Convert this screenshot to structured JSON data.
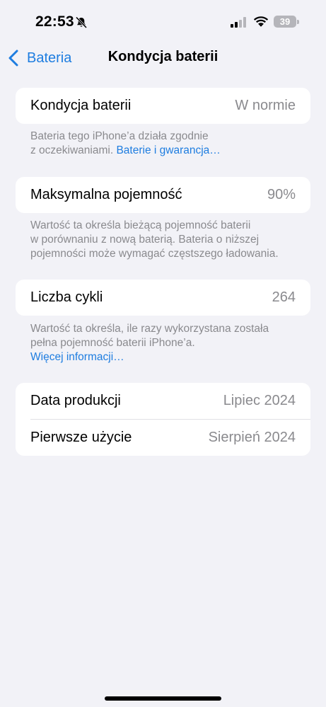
{
  "status_bar": {
    "time": "22:53",
    "battery_level": "39"
  },
  "nav": {
    "back_label": "Bateria",
    "title": "Kondycja baterii"
  },
  "sections": {
    "health": {
      "label": "Kondycja baterii",
      "value": "W normie",
      "note_line1": "Bateria tego iPhone’a działa zgodnie",
      "note_line2": "z oczekiwaniami.",
      "note_link": "Baterie i gwarancja…"
    },
    "capacity": {
      "label": "Maksymalna pojemność",
      "value": "90%",
      "note_line1": "Wartość ta określa bieżącą pojemność baterii",
      "note_line2": "w porównaniu z nową baterią. Bateria o niższej",
      "note_line3": "pojemności może wymagać częstszego ładowania."
    },
    "cycles": {
      "label": "Liczba cykli",
      "value": "264",
      "note_line1": "Wartość ta określa, ile razy wykorzystana została",
      "note_line2": "pełna pojemność baterii iPhone’a.",
      "note_link": "Więcej informacji…"
    },
    "dates": {
      "manufacture_label": "Data produkcji",
      "manufacture_value": "Lipiec 2024",
      "first_use_label": "Pierwsze użycie",
      "first_use_value": "Sierpień 2024"
    }
  },
  "colors": {
    "accent": "#1e7de0",
    "background": "#f2f2f7",
    "secondary_text": "#8a8a8e"
  }
}
